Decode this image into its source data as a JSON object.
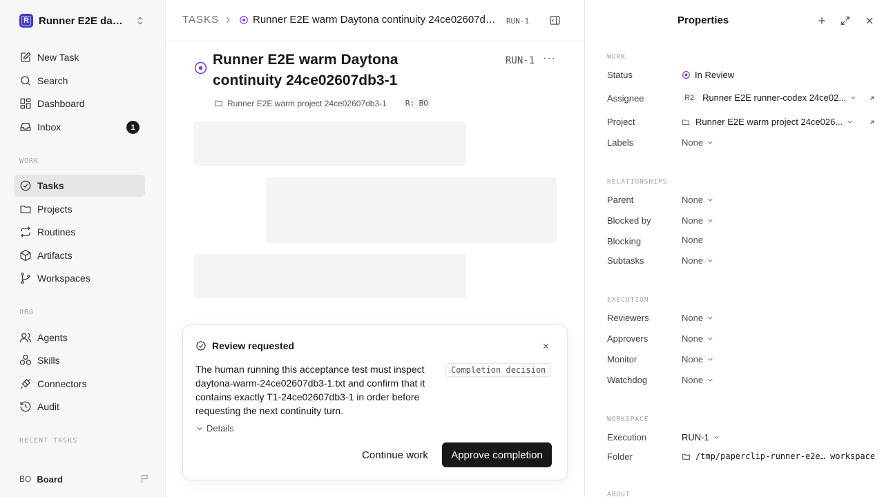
{
  "sidebar": {
    "workspace_logo": "R",
    "workspace_name": "Runner E2E dayt...",
    "nav": [
      {
        "label": "New Task",
        "icon": "edit-icon"
      },
      {
        "label": "Search",
        "icon": "search-icon"
      },
      {
        "label": "Dashboard",
        "icon": "dashboard-icon"
      },
      {
        "label": "Inbox",
        "icon": "inbox-icon",
        "badge": "1"
      }
    ],
    "work_section": "WORK",
    "work_items": [
      {
        "label": "Tasks",
        "icon": "check-circle-icon",
        "active": true
      },
      {
        "label": "Projects",
        "icon": "folder-icon"
      },
      {
        "label": "Routines",
        "icon": "repeat-icon"
      },
      {
        "label": "Artifacts",
        "icon": "box-icon"
      },
      {
        "label": "Workspaces",
        "icon": "git-branch-icon"
      }
    ],
    "org_section": "ORG",
    "org_items": [
      {
        "label": "Agents",
        "icon": "users-icon"
      },
      {
        "label": "Skills",
        "icon": "skills-icon"
      },
      {
        "label": "Connectors",
        "icon": "plug-icon"
      },
      {
        "label": "Audit",
        "icon": "history-icon"
      }
    ],
    "recent_section": "RECENT TASKS",
    "board_initials": "BO",
    "board_label": "Board"
  },
  "main": {
    "breadcrumb_root": "TASKS",
    "breadcrumb_title": "Runner E2E warm Daytona continuity 24ce02607db3-1",
    "breadcrumb_id": "RUN-1",
    "title": "Runner E2E warm Daytona continuity 24ce02607db3-1",
    "task_id": "RUN-1",
    "more": "···",
    "project": "Runner E2E warm project 24ce02607db3-1",
    "ref_chip": "R: BO"
  },
  "review": {
    "title": "Review requested",
    "body": "The human running this acceptance test must inspect daytona-warm-24ce02607db3-1.txt and confirm that it contains exactly T1-24ce02607db3-1 in order before requesting the next continuity turn.",
    "chip": "Completion decision",
    "details": "Details",
    "continue_label": "Continue work",
    "approve_label": "Approve completion"
  },
  "properties": {
    "title": "Properties",
    "work_section": "WORK",
    "status_label": "Status",
    "status_value": "In Review",
    "assignee_label": "Assignee",
    "assignee_chip": "R2",
    "assignee_value": "Runner E2E runner-codex 24ce02...",
    "project_label": "Project",
    "project_value": "Runner E2E warm project 24ce026...",
    "labels_label": "Labels",
    "labels_value": "None",
    "relationships_section": "RELATIONSHIPS",
    "parent_label": "Parent",
    "parent_value": "None",
    "blocked_by_label": "Blocked by",
    "blocked_by_value": "None",
    "blocking_label": "Blocking",
    "blocking_value": "None",
    "subtasks_label": "Subtasks",
    "subtasks_value": "None",
    "execution_section": "EXECUTION",
    "reviewers_label": "Reviewers",
    "reviewers_value": "None",
    "approvers_label": "Approvers",
    "approvers_value": "None",
    "monitor_label": "Monitor",
    "monitor_value": "None",
    "watchdog_label": "Watchdog",
    "watchdog_value": "None",
    "workspace_section": "WORKSPACE",
    "execution_label": "Execution",
    "execution_value": "RUN-1",
    "folder_label": "Folder",
    "folder_value": "/tmp/paperclip-runner-e2e… workspace",
    "about_section": "ABOUT"
  },
  "colors": {
    "status_purple": "#7c3aed",
    "active_nav_bg": "#e6e6e6",
    "primary_button": "#18181b"
  }
}
